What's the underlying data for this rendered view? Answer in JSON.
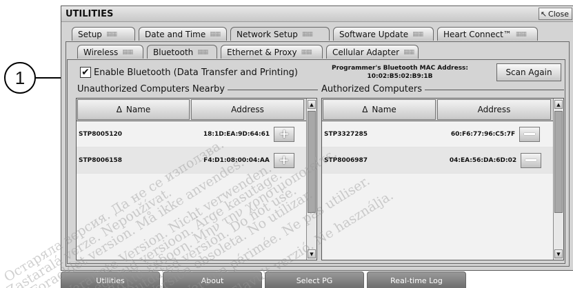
{
  "callout": {
    "number": "1"
  },
  "window": {
    "title": "UTILITIES",
    "close_label": "Close"
  },
  "main_tabs": [
    {
      "label": "Setup"
    },
    {
      "label": "Date and Time"
    },
    {
      "label": "Network Setup",
      "active": true
    },
    {
      "label": "Software Update"
    },
    {
      "label": "Heart Connect™"
    }
  ],
  "sub_tabs": [
    {
      "label": "Wireless"
    },
    {
      "label": "Bluetooth",
      "active": true
    },
    {
      "label": "Ethernet & Proxy"
    },
    {
      "label": "Cellular Adapter"
    }
  ],
  "bluetooth": {
    "enable_label": "Enable Bluetooth (Data Transfer and Printing)",
    "enabled": true,
    "mac_title": "Programmer's Bluetooth MAC Address:",
    "mac_value": "10:02:B5:02:B9:1B",
    "scan_label": "Scan Again"
  },
  "unauthorized": {
    "title": "Unauthorized Computers Nearby",
    "col_name": "Name",
    "col_address": "Address",
    "rows": [
      {
        "name": "STP8005120",
        "address": "18:1D:EA:9D:64:61"
      },
      {
        "name": "STP8006158",
        "address": "F4:D1:08:00:04:AA"
      }
    ]
  },
  "authorized": {
    "title": "Authorized Computers",
    "col_name": "Name",
    "col_address": "Address",
    "rows": [
      {
        "name": "STP3327285",
        "address": "60:F6:77:96:C5:7F"
      },
      {
        "name": "STP8006987",
        "address": "04:EA:56:DA:6D:02"
      }
    ]
  },
  "bottom_nav": [
    {
      "label": "Utilities"
    },
    {
      "label": "About"
    },
    {
      "label": "Select PG"
    },
    {
      "label": "Real-time Log"
    }
  ],
  "watermark": [
    "Остаряла версия. Да не се използва.",
    "Zastaralá verze. Nepoužívat.",
    "Foraeldet version. Må ikke anvendes.",
    "Veraltete Version. Nicht verwenden.",
    "Aegunud versioon. Ärge kasutage.",
    "Παλιά έκδοση. Μην την χρησιμοποιείτε.",
    "Outdated version. Do not use.",
    "Versión obsoleta. No utilizar.",
    "Version périmée. Ne pas utiliser.",
    "Elavult verzió. Ne használja."
  ]
}
